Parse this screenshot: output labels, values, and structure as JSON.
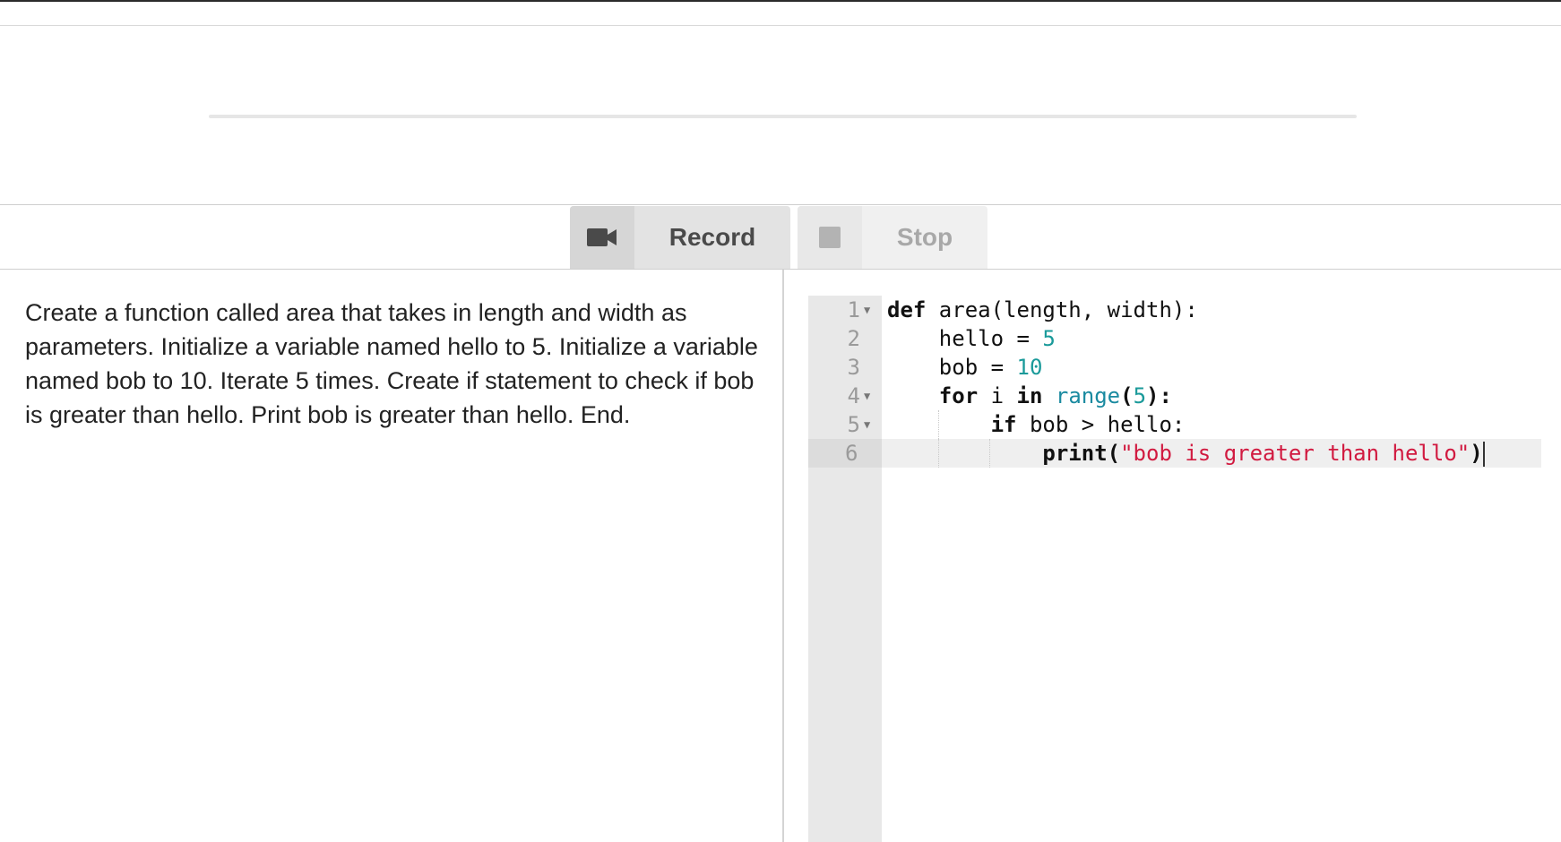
{
  "toolbar": {
    "record_label": "Record",
    "stop_label": "Stop",
    "record_icon": "video-camera-icon",
    "stop_icon": "stop-square-icon"
  },
  "instructions": {
    "text": "Create a function called area that takes in length and width as parameters. Initialize a variable named hello to 5. Initialize a variable named bob to 10. Iterate 5 times. Create if statement to check if bob is greater than hello. Print bob is greater than hello. End."
  },
  "editor": {
    "line_numbers": [
      "1",
      "2",
      "3",
      "4",
      "5",
      "6"
    ],
    "active_line": 6,
    "foldable_lines": [
      1,
      4,
      5
    ],
    "lines": [
      {
        "kw": "def",
        "rest": " area(length, width):"
      },
      {
        "indent": "    ",
        "text": "hello = ",
        "num": "5"
      },
      {
        "indent": "    ",
        "text": "bob = ",
        "num": "10"
      },
      {
        "indent": "    ",
        "kw1": "for",
        "t1": " i ",
        "kw2": "in",
        "t2": " ",
        "fn": "range",
        "p1": "(",
        "num": "5",
        "p2": "):"
      },
      {
        "indent": "        ",
        "kw": "if",
        "rest": " bob > hello:"
      },
      {
        "indent": "            ",
        "kw": "print",
        "p1": "(",
        "str": "\"bob is greater than hello\"",
        "p2": ")"
      }
    ]
  },
  "colors": {
    "number": "#1a9a9a",
    "builtin": "#1a8aa0",
    "string": "#d11a40",
    "gutter": "#e8e8e8"
  }
}
